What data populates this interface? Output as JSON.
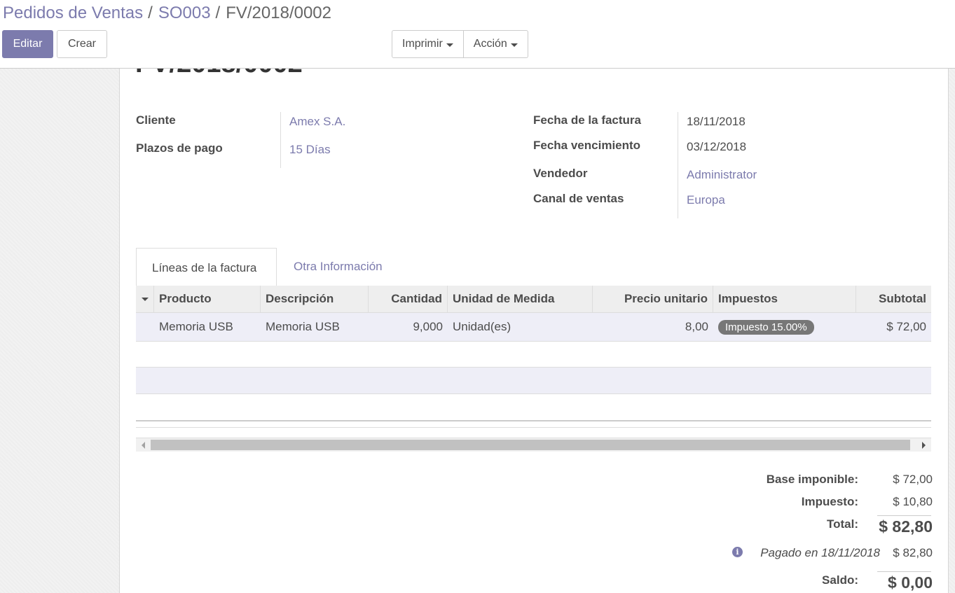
{
  "breadcrumb": {
    "items": [
      "Pedidos de Ventas",
      "SO003"
    ],
    "separator": "/",
    "current": "FV/2018/0002"
  },
  "buttons": {
    "edit": "Editar",
    "create": "Crear",
    "print": "Imprimir",
    "action": "Acción"
  },
  "document": {
    "title": "FV/2018/0002"
  },
  "fields_left": [
    {
      "label": "Cliente",
      "value": "Amex S.A."
    },
    {
      "label": "Plazos de pago",
      "value": "15 Días"
    }
  ],
  "fields_right": [
    {
      "label": "Fecha de la factura",
      "value": "18/11/2018"
    },
    {
      "label": "Fecha vencimiento",
      "value": "03/12/2018"
    },
    {
      "label": "Vendedor",
      "value": "Administrator"
    },
    {
      "label": "Canal de ventas",
      "value": "Europa"
    }
  ],
  "tabs": [
    "Líneas de la factura",
    "Otra Información"
  ],
  "table": {
    "headers": [
      "Producto",
      "Descripción",
      "Cantidad",
      "Unidad de Medida",
      "Precio unitario",
      "Impuestos",
      "Subtotal"
    ],
    "rows": [
      {
        "product": "Memoria USB",
        "description": "Memoria USB",
        "quantity": "9,000",
        "uom": "Unidad(es)",
        "price": "8,00",
        "tax": "Impuesto 15.00%",
        "subtotal": "$ 72,00"
      }
    ]
  },
  "totals": {
    "base_label": "Base imponible:",
    "base_value": "$ 72,00",
    "tax_label": "Impuesto:",
    "tax_value": "$ 10,80",
    "total_label": "Total:",
    "total_value": "$ 82,80",
    "payment_text": "Pagado en 18/11/2018",
    "payment_value": "$ 82,80",
    "balance_label": "Saldo:",
    "balance_value": "$ 0,00"
  },
  "colors": {
    "primary": "#7c7bad",
    "tag": "#777777",
    "row_selected": "#eeeef7"
  }
}
